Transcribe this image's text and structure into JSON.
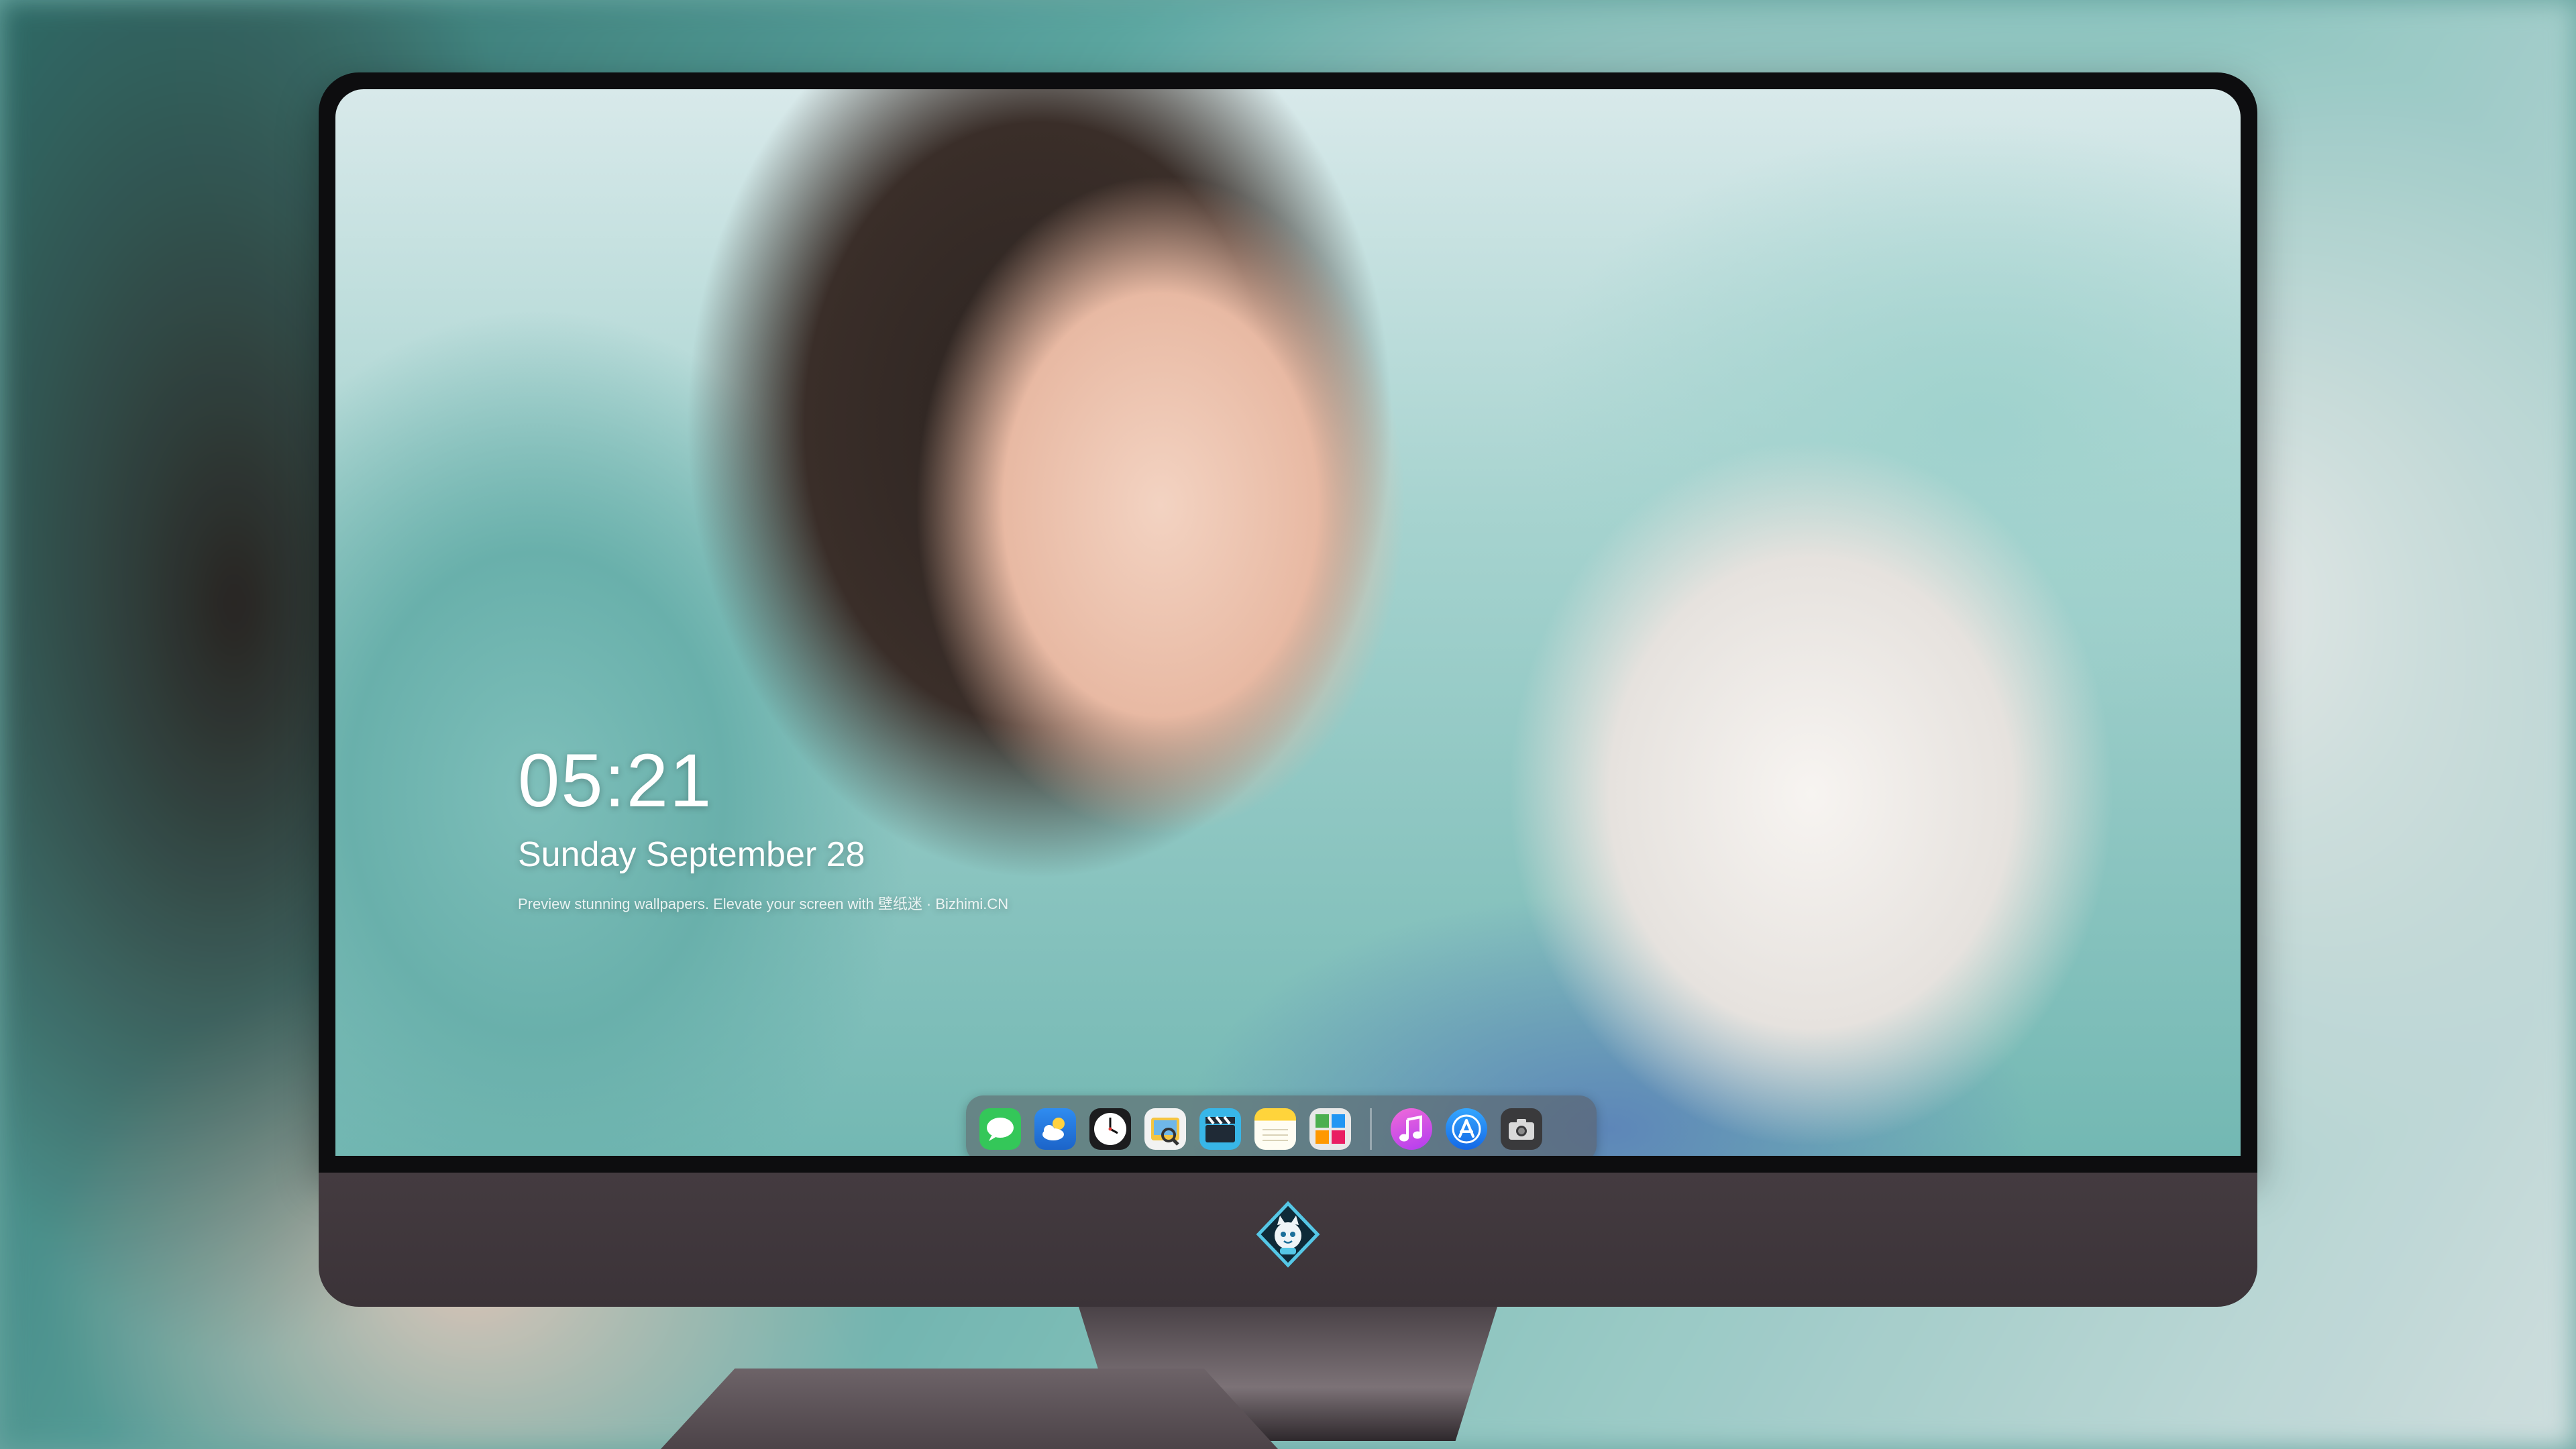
{
  "lock_screen": {
    "time": "05:21",
    "date": "Sunday September  28",
    "tagline": "Preview stunning wallpapers. Elevate your screen with 壁纸迷 · Bizhimi.CN"
  },
  "dock": {
    "apps": [
      {
        "name": "Messages",
        "icon": "messages-icon",
        "color": "#34c759"
      },
      {
        "name": "Weather",
        "icon": "weather-icon",
        "color": "#1e88e5"
      },
      {
        "name": "Clock",
        "icon": "clock-icon",
        "color": "#1c1c1e"
      },
      {
        "name": "Preview",
        "icon": "preview-icon",
        "color": "#f4c542"
      },
      {
        "name": "Clips",
        "icon": "clapperboard-icon",
        "color": "#38b6e8"
      },
      {
        "name": "Notes",
        "icon": "notes-icon",
        "color": "#ffd43b"
      },
      {
        "name": "Photo Booth",
        "icon": "photos-icon",
        "color": "#e8e8e8"
      },
      {
        "name": "iTunes",
        "icon": "music-icon",
        "color": "#d946ef"
      },
      {
        "name": "App Store",
        "icon": "app-store-icon",
        "color": "#1a8cff"
      },
      {
        "name": "Screenshot",
        "icon": "camera-icon",
        "color": "#3a3a3c"
      }
    ]
  },
  "branding": {
    "logo": "mascot-logo-icon",
    "accent": "#55c7e6"
  }
}
